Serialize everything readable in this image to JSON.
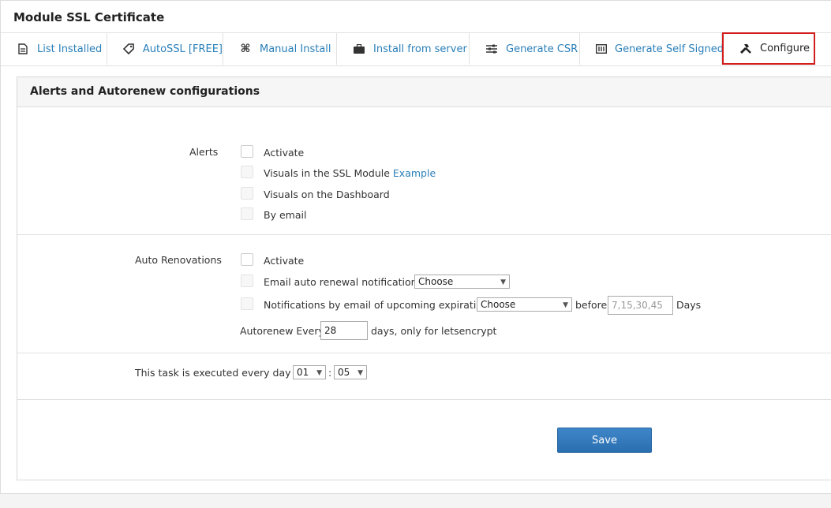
{
  "module": {
    "title": "Module SSL Certificate"
  },
  "tabs": [
    {
      "label": "List Installed",
      "icon": "document-icon"
    },
    {
      "label": "AutoSSL [FREE]",
      "icon": "tag-icon"
    },
    {
      "label": "Manual Install",
      "icon": "command-icon"
    },
    {
      "label": "Install from server",
      "icon": "briefcase-icon"
    },
    {
      "label": "Generate CSR",
      "icon": "sliders-icon"
    },
    {
      "label": "Generate Self Signed",
      "icon": "certificate-icon"
    },
    {
      "label": "Configure",
      "icon": "tools-icon",
      "active": true
    }
  ],
  "panel": {
    "title": "Alerts and Autorenew configurations",
    "alerts": {
      "label": "Alerts",
      "activate": "Activate",
      "visuals_ssl": "Visuals in the SSL Module",
      "example_link": "Example",
      "visuals_dashboard": "Visuals on the Dashboard",
      "by_email": "By email"
    },
    "auto": {
      "label": "Auto Renovations",
      "activate": "Activate",
      "email_notif": "Email auto renewal notifications",
      "email_notif_select": "Choose",
      "upcoming": "Notifications by email of upcoming expiration",
      "upcoming_select": "Choose",
      "before": "before",
      "days_placeholder": "7,15,30,45",
      "days": "Days",
      "every_prefix": "Autorenew Every",
      "every_value": "28",
      "every_suffix": "days, only for letsencrypt"
    },
    "schedule": {
      "label": "This task is executed every day at:",
      "hour": "01",
      "sep": ":",
      "minute": "05"
    },
    "save": "Save"
  },
  "colors": {
    "link": "#2a7fb8",
    "active_tab_border": "#d21d1d",
    "button": "#2a6fb0"
  }
}
